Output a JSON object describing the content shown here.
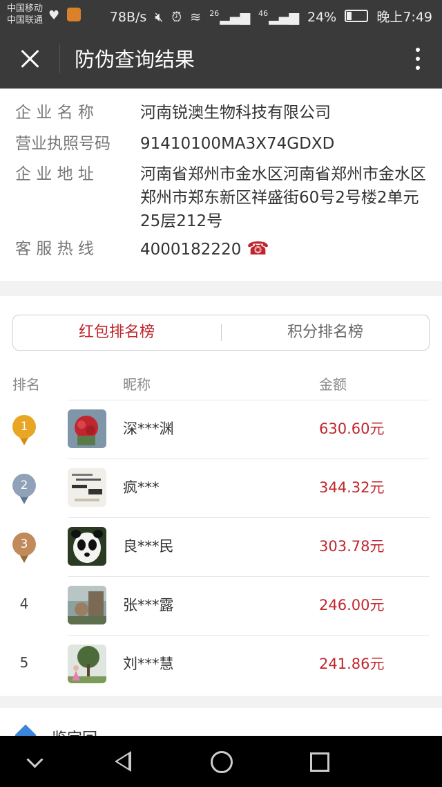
{
  "status_bar": {
    "carrier1": "中国移动",
    "carrier2": "中国联通",
    "speed": "78B/s",
    "signal1": "26",
    "signal2": "46",
    "battery": "24%",
    "time": "晚上7:49"
  },
  "header": {
    "title": "防伪查询结果"
  },
  "company": {
    "name_label": "企 业 名 称",
    "name": "河南锐澳生物科技有限公司",
    "license_label": "营业执照号码",
    "license": "91410100MA3X74GDXD",
    "address_label": "企 业 地 址",
    "address": "河南省郑州市金水区河南省郑州市金水区郑州市郑东新区祥盛街60号2号楼2单元25层212号",
    "hotline_label": "客 服 热 线",
    "hotline": "4000182220",
    "hotline_icon": "phone-icon"
  },
  "ranking": {
    "tabs": [
      {
        "label": "红包排名榜",
        "active": true
      },
      {
        "label": "积分排名榜",
        "active": false
      }
    ],
    "columns": {
      "rank": "排名",
      "nickname": "昵称",
      "amount": "金额"
    },
    "rows": [
      {
        "rank": "1",
        "nickname": "深***渊",
        "amount": "630.60元"
      },
      {
        "rank": "2",
        "nickname": "疯***",
        "amount": "344.32元"
      },
      {
        "rank": "3",
        "nickname": "良***民",
        "amount": "303.78元"
      },
      {
        "rank": "4",
        "nickname": "张***露",
        "amount": "246.00元"
      },
      {
        "rank": "5",
        "nickname": "刘***慧",
        "amount": "241.86元"
      }
    ]
  },
  "bottom": {
    "text": "鉴定回"
  },
  "colors": {
    "accent": "#c0262d",
    "gold": "#e9a625",
    "silver": "#8fa2b8",
    "bronze": "#c08a5a"
  }
}
